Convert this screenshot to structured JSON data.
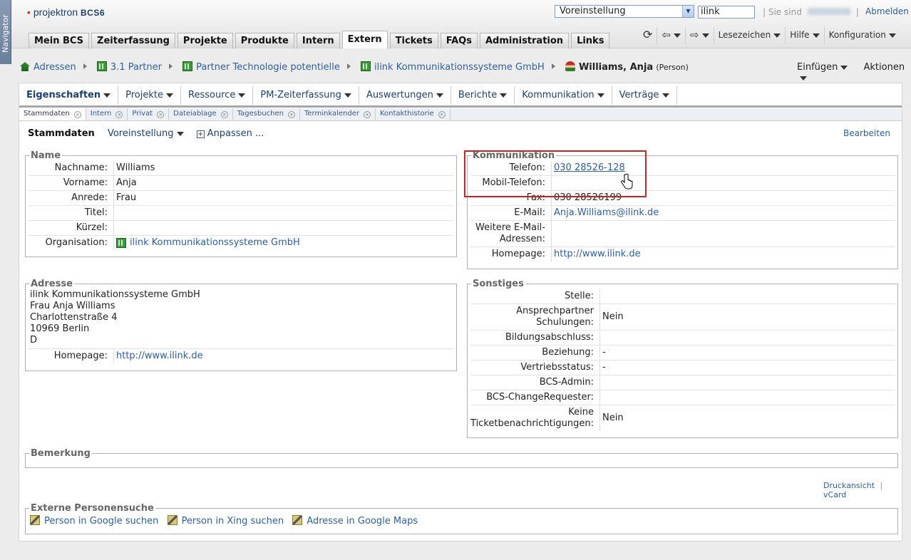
{
  "navigator": "Navigator",
  "header": {
    "logo_name": "projektron",
    "logo_suffix": "BCS6",
    "preset_select": "Voreinstellung",
    "search_value": "ilink",
    "logged_in_label": "Sie sind",
    "logout": "Abmelden"
  },
  "main_tabs": [
    "Mein BCS",
    "Zeiterfassung",
    "Projekte",
    "Produkte",
    "Intern",
    "Extern",
    "Tickets",
    "FAQs",
    "Administration",
    "Links"
  ],
  "active_main_tab": "Extern",
  "toolbar": {
    "bookmarks": "Lesezeichen",
    "help": "Hilfe",
    "config": "Konfiguration"
  },
  "breadcrumb": [
    "Adressen",
    "3.1 Partner",
    "Partner Technologie potentielle",
    "ilink Kommunikationssysteme GmbH"
  ],
  "current_person": {
    "name": "Williams, Anja",
    "type": "(Person)"
  },
  "actions": {
    "insert": "Einfügen",
    "actions": "Aktionen"
  },
  "sub_nav": [
    "Eigenschaften",
    "Projekte",
    "Ressource",
    "PM-Zeiterfassung",
    "Auswertungen",
    "Berichte",
    "Kommunikation",
    "Verträge"
  ],
  "page_tabs": [
    "Stammdaten",
    "Intern",
    "Privat",
    "Dateiablage",
    "Tagesbuchen",
    "Terminkalender",
    "Kontakthistorie"
  ],
  "page_header": {
    "title": "Stammdaten",
    "preset": "Voreinstellung",
    "customize": "Anpassen ...",
    "edit": "Bearbeiten"
  },
  "name_section": {
    "legend": "Name",
    "rows": [
      {
        "label": "Nachname:",
        "value": "Williams"
      },
      {
        "label": "Vorname:",
        "value": "Anja"
      },
      {
        "label": "Anrede:",
        "value": "Frau"
      },
      {
        "label": "Titel:",
        "value": ""
      },
      {
        "label": "Kürzel:",
        "value": ""
      },
      {
        "label": "Organisation:",
        "value": "ilink Kommunikationssysteme GmbH"
      }
    ]
  },
  "comm_section": {
    "legend": "Kommunikation",
    "rows": [
      {
        "label": "Telefon:",
        "value": "030 28526-128"
      },
      {
        "label": "Mobil-Telefon:",
        "value": ""
      },
      {
        "label": "Fax:",
        "value": "030 28526199"
      },
      {
        "label": "E-Mail:",
        "value": "Anja.Williams@ilink.de"
      },
      {
        "label": "Weitere E-Mail-Adressen:",
        "value": ""
      },
      {
        "label": "Homepage:",
        "value": "http://www.ilink.de"
      }
    ]
  },
  "address_section": {
    "legend": "Adresse",
    "lines": [
      "ilink Kommunikationssysteme GmbH",
      "Frau Anja Williams",
      "Charlottenstraße 4",
      "10969 Berlin",
      "D"
    ],
    "homepage_label": "Homepage:",
    "homepage": "http://www.ilink.de"
  },
  "misc_section": {
    "legend": "Sonstiges",
    "rows": [
      {
        "label": "Stelle:",
        "value": ""
      },
      {
        "label": "Ansprechpartner Schulungen:",
        "value": "Nein"
      },
      {
        "label": "Bildungsabschluss:",
        "value": ""
      },
      {
        "label": "Beziehung:",
        "value": "-"
      },
      {
        "label": "Vertriebsstatus:",
        "value": "-"
      },
      {
        "label": "BCS-Admin:",
        "value": ""
      },
      {
        "label": "BCS-ChangeRequester:",
        "value": ""
      },
      {
        "label": "Keine Ticketbenachrichtigungen:",
        "value": "Nein"
      }
    ]
  },
  "remark": {
    "legend": "Bemerkung"
  },
  "footer_links": {
    "print": "Druckansicht",
    "vcard": "vCard"
  },
  "external_search": {
    "legend": "Externe Personensuche",
    "links": [
      "Person in Google suchen",
      "Person in Xing suchen",
      "Adresse in Google Maps"
    ]
  },
  "colors": {
    "link": "#2e5e9e",
    "highlight_box": "#c42424"
  }
}
